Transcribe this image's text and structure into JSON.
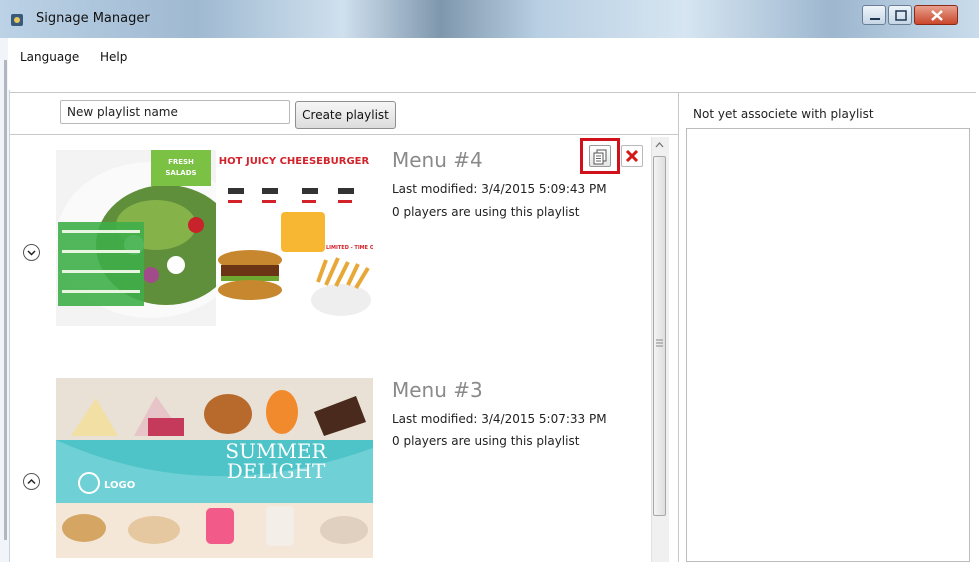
{
  "window": {
    "title": "Signage Manager"
  },
  "menu": {
    "items": [
      "Language",
      "Help"
    ]
  },
  "toolbar": {
    "playlist_input_value": "New playlist name",
    "create_label": "Create playlist"
  },
  "right_panel": {
    "header": "Not yet associete with playlist"
  },
  "playlists": [
    {
      "name": "Menu #4",
      "modified": "Last modified: 3/4/2015 5:09:43 PM",
      "players": "0 players are using this playlist",
      "thumbnail": {
        "banner_fresh": "FRESH\nSALADS",
        "headline": "HOT JUICY CHEESEBURGER",
        "sub": "LIMITED - TIME OFFER"
      }
    },
    {
      "name": "Menu #3",
      "modified": "Last modified: 3/4/2015 5:07:33 PM",
      "players": "0 players are using this playlist",
      "thumbnail": {
        "line1": "SUMMER",
        "line2": "DELIGHT",
        "logo": "LOGO"
      }
    }
  ],
  "colors": {
    "highlight": "#d0101a",
    "delete": "#d21a1a",
    "titlebar": "#b9cfe3"
  },
  "icons": [
    "app-icon",
    "minimize-icon",
    "maximize-icon",
    "close-icon",
    "copy-icon",
    "delete-icon",
    "chevron-down-icon",
    "chevron-up-icon",
    "scroll-up-arrow-icon",
    "scroll-grip-icon"
  ]
}
